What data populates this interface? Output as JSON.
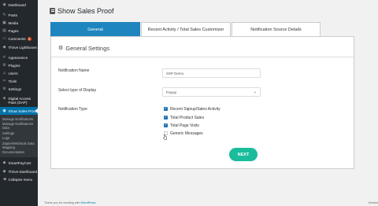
{
  "sidebar": {
    "group1": [
      {
        "icon": "dashboard-icon",
        "glyph": "◉",
        "label": "Dashboard"
      }
    ],
    "group2": [
      {
        "icon": "pin-icon",
        "glyph": "✎",
        "label": "Posts"
      },
      {
        "icon": "media-icon",
        "glyph": "▣",
        "label": "Media"
      },
      {
        "icon": "pages-icon",
        "glyph": "▤",
        "label": "Pages"
      },
      {
        "icon": "comments-icon",
        "glyph": "▭",
        "label": "Comments",
        "badge": "0"
      },
      {
        "icon": "thrive-lightboxes-icon",
        "glyph": "◆",
        "label": "Thrive Lightboxes"
      }
    ],
    "group3": [
      {
        "icon": "appearance-icon",
        "glyph": "✐",
        "label": "Appearance"
      },
      {
        "icon": "plugins-icon",
        "glyph": "⚙",
        "label": "Plugins"
      },
      {
        "icon": "users-icon",
        "glyph": "☺",
        "label": "Users"
      },
      {
        "icon": "tools-icon",
        "glyph": "✂",
        "label": "Tools"
      },
      {
        "icon": "settings-icon",
        "glyph": "⚙",
        "label": "Settings"
      }
    ],
    "dap": {
      "icon": "dap-icon",
      "glyph": "◈",
      "label": "Digital Access Pass (DAP)"
    },
    "active": {
      "icon": "show-sales-proof-icon",
      "glyph": "◉",
      "label": "Show Sales Proof"
    },
    "submenu": [
      "Manage Notifications",
      "Manage Notifications Data",
      "Settings",
      "Logs",
      "Zapier/Webhook Data Mapping",
      "Documentation"
    ],
    "group4": [
      {
        "icon": "smartpaycart-icon",
        "glyph": "◆",
        "label": "SmartPayCart"
      },
      {
        "icon": "thrive-dashboard-icon",
        "glyph": "◆",
        "label": "Thrive Dashboard"
      },
      {
        "icon": "collapse-menu-icon",
        "glyph": "◀",
        "label": "Collapse menu"
      }
    ]
  },
  "page": {
    "title": "Show Sales Proof"
  },
  "tabs": [
    "General",
    "Recent Activity / Total Sales Customizer",
    "Notification Source Details"
  ],
  "panel": {
    "heading": "General Settings",
    "notification_name_label": "Notification Name",
    "notification_name_value": "SSP Demo",
    "display_type_label": "Select type of Display",
    "display_type_value": "Popup",
    "notification_type_label": "Notification Type",
    "options": [
      {
        "label": "Recent Signup/Sales Activity",
        "checked": true
      },
      {
        "label": "Total Product Sales",
        "checked": true
      },
      {
        "label": "Total Page Visits",
        "checked": true
      },
      {
        "label": "Generic Messages",
        "checked": false
      }
    ],
    "next_label": "NEXT"
  },
  "footer": {
    "prefix": "Thank you for creating with ",
    "link": "WordPress",
    "suffix": ".",
    "version": "Version"
  },
  "colors": {
    "sidebar_bg": "#23282d",
    "sidebar_active": "#0073aa",
    "tab_active": "#1e85be",
    "checkbox_checked": "#2271b1",
    "next_button": "#1abc9c"
  }
}
